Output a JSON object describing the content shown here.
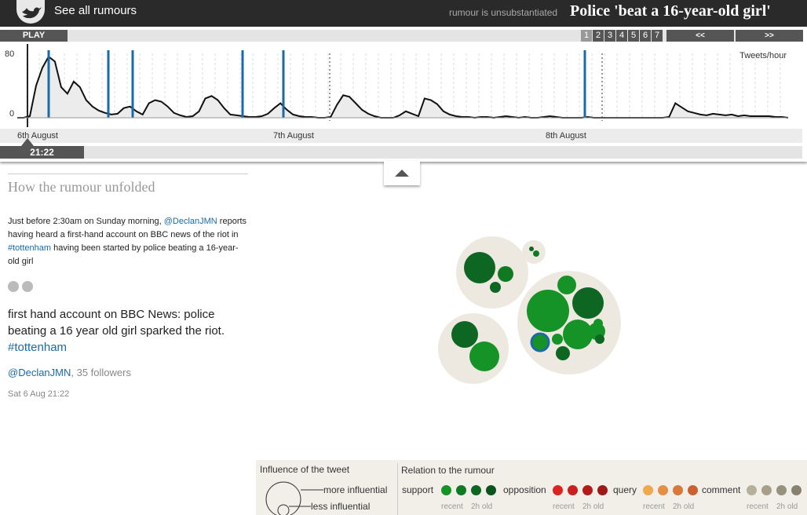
{
  "header": {
    "see_all": "See all rumours",
    "status": "rumour is unsubstantiated",
    "title": "Police 'beat a 16-year-old girl'"
  },
  "timeline": {
    "play_label": "PLAY",
    "pages": [
      "1",
      "2",
      "3",
      "4",
      "5",
      "6",
      "7"
    ],
    "active_page": "1",
    "prev_label": "<<",
    "next_label": ">>",
    "y_top": "80",
    "y_bottom": "0",
    "units": "Tweets/hour",
    "dates": [
      "6th August",
      "7th August",
      "8th August"
    ],
    "current_time": "21:22"
  },
  "chart_data": {
    "type": "area",
    "ylabel": "Tweets/hour",
    "ylim": [
      0,
      80
    ],
    "x_labels": [
      "6th August",
      "7th August",
      "8th August"
    ],
    "values": [
      0,
      0,
      2,
      40,
      62,
      76,
      70,
      38,
      30,
      45,
      38,
      22,
      14,
      9,
      6,
      4,
      5,
      12,
      14,
      8,
      4,
      18,
      22,
      20,
      14,
      6,
      3,
      1,
      2,
      8,
      24,
      27,
      22,
      12,
      4,
      3,
      2,
      1,
      1,
      2,
      5,
      12,
      18,
      10,
      4,
      2,
      1,
      1,
      0,
      0,
      1,
      16,
      28,
      26,
      18,
      10,
      5,
      2,
      0,
      0,
      0,
      3,
      8,
      5,
      2,
      24,
      22,
      17,
      8,
      4,
      2,
      1,
      1,
      0,
      1,
      1,
      0,
      1,
      2,
      1,
      0,
      1,
      0,
      0,
      1,
      2,
      1,
      0,
      0,
      0,
      0,
      1,
      0,
      0,
      0,
      0,
      0,
      0,
      0,
      0,
      0,
      0,
      0,
      0,
      1,
      18,
      13,
      8,
      6,
      4,
      3,
      5,
      4,
      3,
      4,
      2,
      3,
      2,
      2,
      2,
      2,
      1,
      1,
      0
    ]
  },
  "story": {
    "heading": "How the rumour unfolded",
    "intro_1": "Just before 2:30am on Sunday morning, ",
    "intro_user": "@DeclanJMN",
    "intro_2": " reports having heard a first-hand account on BBC news of the riot in ",
    "intro_tag": "#tottenham",
    "intro_3": " having been started by police beating a 16-year-old girl",
    "quote": "first hand account on BBC News: police beating a 16 year old girl sparked the riot. ",
    "quote_tag": "#tottenham",
    "tweet_user": "@DeclanJMN",
    "tweet_followers": ", 35 followers",
    "tweet_date": "Sat 6 Aug 21:22"
  },
  "legend": {
    "influence_title": "Influence of the tweet",
    "more": "more influential",
    "less": "less influential",
    "relation_title": "Relation to the rumour",
    "categories": [
      {
        "label": "support",
        "colors": [
          "#159326",
          "#0f7a22",
          "#0d6622",
          "#0a5420"
        ]
      },
      {
        "label": "opposition",
        "colors": [
          "#dd2222",
          "#c81f1f",
          "#b31b1b",
          "#9e1818"
        ]
      },
      {
        "label": "query",
        "colors": [
          "#f0a850",
          "#e58f45",
          "#d8783b",
          "#c96233"
        ]
      },
      {
        "label": "comment",
        "colors": [
          "#b5b09a",
          "#a6a08a",
          "#96917c",
          "#87826e"
        ]
      }
    ],
    "recent": "recent",
    "old": "2h old"
  }
}
